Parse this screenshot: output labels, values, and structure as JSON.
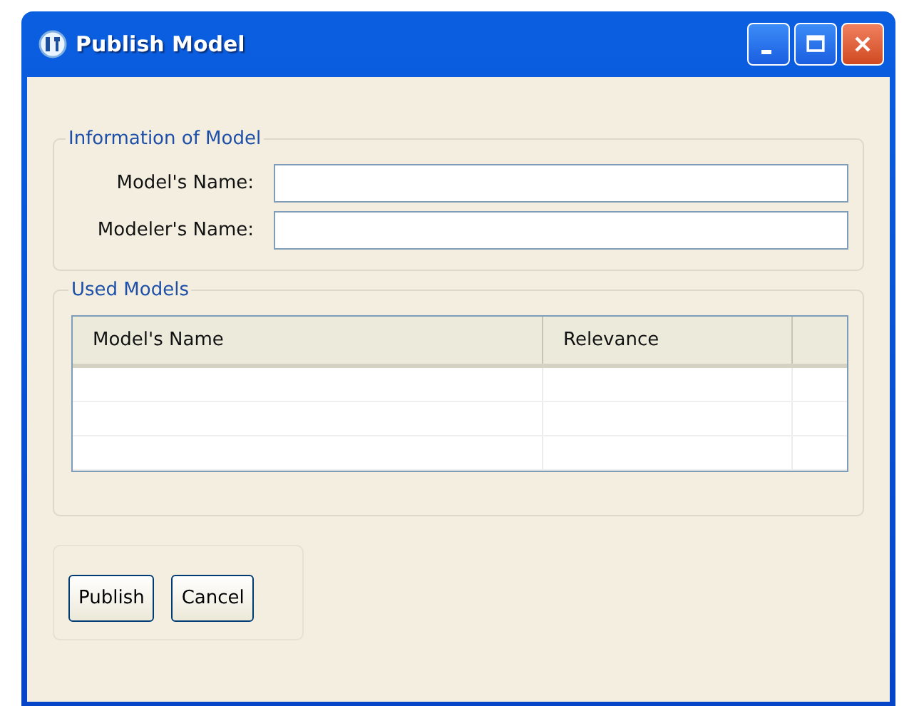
{
  "window": {
    "title": "Publish Model"
  },
  "information_group": {
    "legend": "Information of Model",
    "fields": [
      {
        "label": "Model's Name:"
      },
      {
        "label": "Modeler's Name:"
      }
    ]
  },
  "used_models_group": {
    "legend": "Used Models",
    "table": {
      "columns": [
        "Model's Name",
        "Relevance"
      ]
    }
  },
  "buttons": [
    "Publish",
    "Cancel"
  ]
}
